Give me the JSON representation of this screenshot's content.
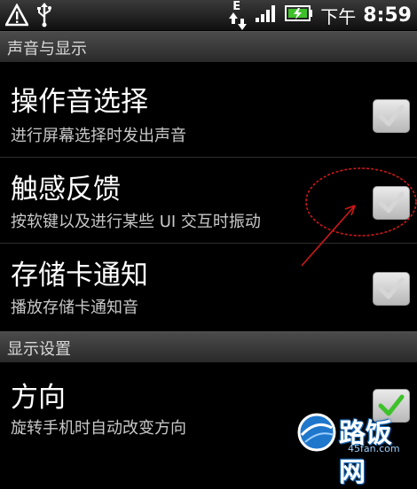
{
  "status_bar": {
    "time": "8:59",
    "am_pm": "下午",
    "network_type": "E",
    "icons": [
      "warning-icon",
      "usb-icon",
      "data-arrows-icon",
      "signal-icon",
      "battery-icon"
    ]
  },
  "sections": {
    "sound_display": "声音与显示",
    "display_settings": "显示设置"
  },
  "items": {
    "touch_sound": {
      "title": "操作音选择",
      "summary": "进行屏幕选择时发出声音",
      "checked": true
    },
    "haptic": {
      "title": "触感反馈",
      "summary": "按软键以及进行某些 UI 交互时振动",
      "checked": true
    },
    "sd_notify": {
      "title": "存储卡通知",
      "summary": "播放存储卡通知音",
      "checked": true
    },
    "orientation": {
      "title": "方向",
      "summary": "旋转手机时自动改变方向",
      "checked": true
    }
  },
  "watermark": {
    "text": "路饭网",
    "url": "45fan.com"
  },
  "colors": {
    "annotation": "#d01818",
    "check_green": "#3ec12a",
    "check_gray": "#d6d6d6"
  }
}
